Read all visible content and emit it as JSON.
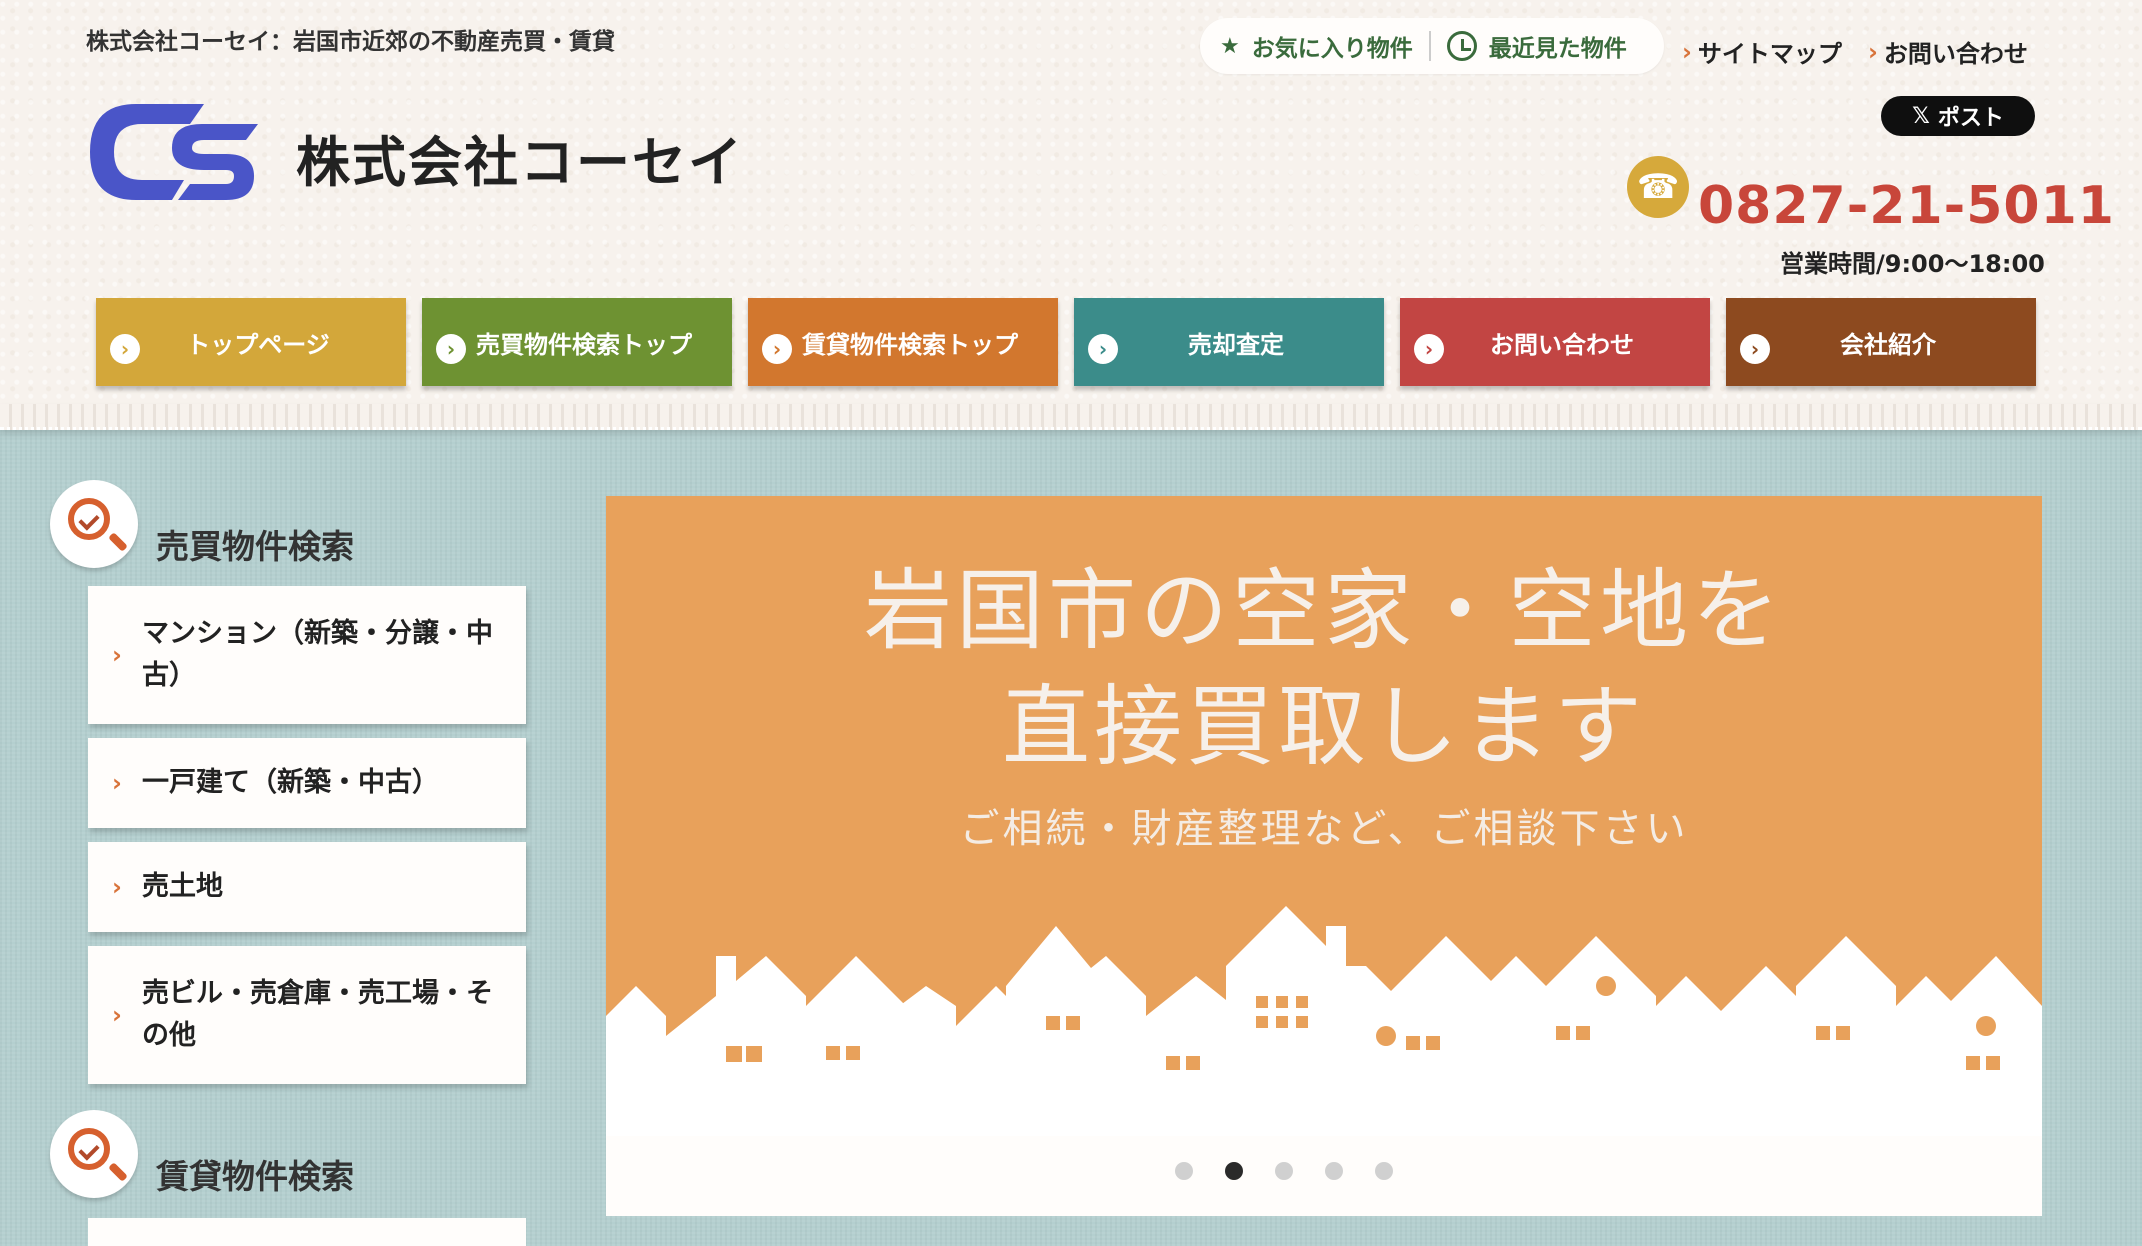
{
  "header": {
    "tagline": "株式会社コーセイ：岩国市近郊の不動産売買・賃貸",
    "favorites_label": "お気に入り物件",
    "recent_label": "最近見た物件",
    "sitemap_label": "サイトマップ",
    "contact_label": "お問い合わせ",
    "post_label": "ポスト",
    "company_name": "株式会社コーセイ",
    "logo_text": "CS",
    "phone": "0827-21-5011",
    "hours": "営業時間/9:00〜18:00"
  },
  "nav": {
    "items": [
      {
        "label": "トップページ",
        "color": "#d3a73a"
      },
      {
        "label": "売買物件検索トップ",
        "color": "#6e9232"
      },
      {
        "label": "賃貸物件検索トップ",
        "color": "#d2772e"
      },
      {
        "label": "売却査定",
        "color": "#3b8c8a"
      },
      {
        "label": "お問い合わせ",
        "color": "#c24543"
      },
      {
        "label": "会社紹介",
        "color": "#8d4a1f"
      }
    ]
  },
  "sidebar": {
    "sale_title": "売買物件検索",
    "sale_items": [
      {
        "label": "マンション（新築・分譲・中古）"
      },
      {
        "label": "一戸建て（新築・中古）"
      },
      {
        "label": "売土地"
      },
      {
        "label": "売ビル・売倉庫・売工場・その他"
      }
    ],
    "rent_title": "賃貸物件検索"
  },
  "slider": {
    "headline_line1": "岩国市の空家・空地を",
    "headline_line2": "直接買取します",
    "subtext": "ご相続・財産整理など、ご相談下さい",
    "slide_count": 5,
    "active_slide": 2,
    "background": "#e8a15b"
  }
}
